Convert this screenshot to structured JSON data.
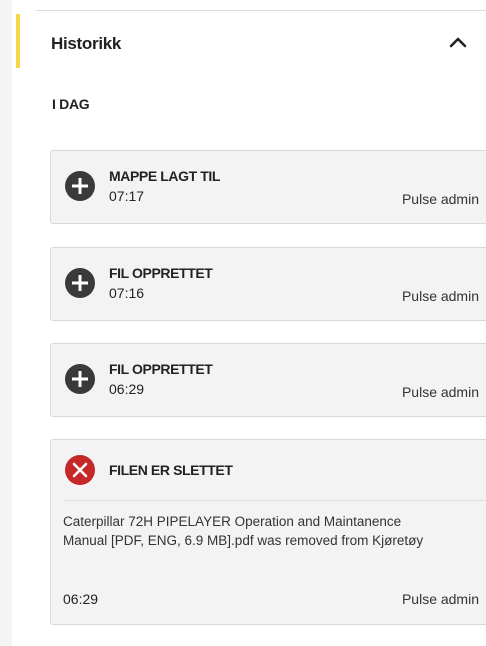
{
  "history": {
    "title": "Historikk",
    "collapse_icon": "chevron-up-icon",
    "group_label": "I DAG",
    "colors": {
      "accent": "#f7d64a",
      "add_icon": "#3a3a3a",
      "delete_icon": "#c62828",
      "card_bg": "#f3f3f3"
    },
    "events": [
      {
        "icon": "plus-circle-icon",
        "title": "MAPPE LAGT TIL",
        "time": "07:17",
        "user": "Pulse admin"
      },
      {
        "icon": "plus-circle-icon",
        "title": "FIL OPPRETTET",
        "time": "07:16",
        "user": "Pulse admin"
      },
      {
        "icon": "plus-circle-icon",
        "title": "FIL OPPRETTET",
        "time": "06:29",
        "user": "Pulse admin"
      },
      {
        "icon": "close-circle-icon",
        "title": "FILEN ER SLETTET",
        "description": "Caterpillar 72H PIPELAYER Operation and Maintanence Manual [PDF, ENG, 6.9 MB].pdf was removed from Kjøretøy",
        "time": "06:29",
        "user": "Pulse admin"
      }
    ]
  }
}
